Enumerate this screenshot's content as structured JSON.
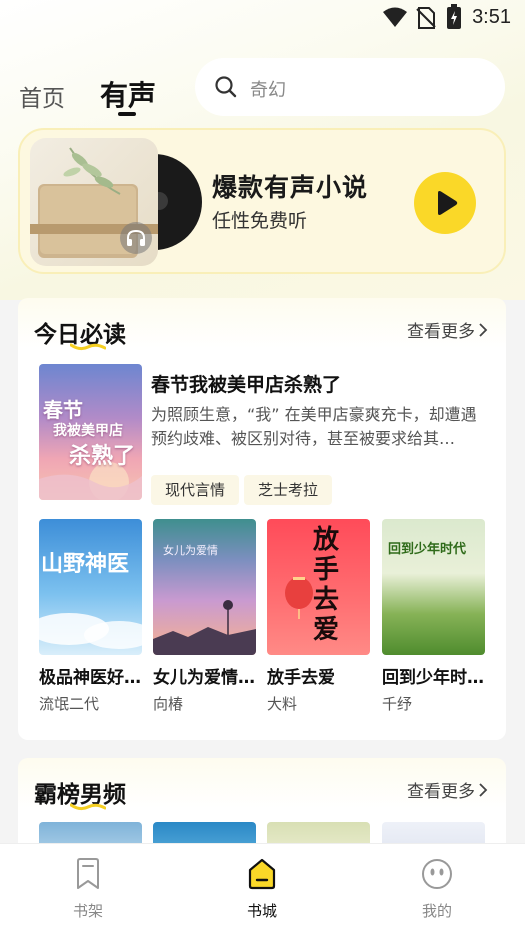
{
  "status_bar": {
    "time": "3:51",
    "icons": [
      "wifi-icon",
      "no-sim-icon",
      "battery-charging-icon"
    ]
  },
  "header": {
    "tabs": [
      {
        "label": "首页"
      },
      {
        "label": "有声",
        "active": true
      }
    ],
    "search": {
      "placeholder": "奇幻",
      "icon": "search-icon"
    }
  },
  "banner": {
    "title": "爆款有声小说",
    "subtitle": "任性免费听",
    "icon": "play-icon"
  },
  "today_section": {
    "title": "今日必读",
    "more_label": "查看更多",
    "featured": {
      "cover_text": [
        "春节",
        "我被美甲店",
        "杀熟了"
      ],
      "title": "春节我被美甲店杀熟了",
      "description": "为照顾生意，“我” 在美甲店豪爽充卡，却遭遇预约歧难、被区别对待，甚至被要求给其…",
      "tags": [
        "现代言情",
        "芝士考拉"
      ]
    },
    "books": [
      {
        "name": "极品神医好…",
        "author": "流氓二代",
        "cover_text": "山野神医"
      },
      {
        "name": "女儿为爱情…",
        "author": "向椿",
        "cover_text": "女儿为爱情"
      },
      {
        "name": "放手去爱",
        "author": "大料",
        "cover_text": "放手去爱"
      },
      {
        "name": "回到少年时…",
        "author": "千纾",
        "cover_text": "回到少年时代"
      }
    ]
  },
  "male_section": {
    "title": "霸榜男频",
    "more_label": "查看更多"
  },
  "bottom_nav": [
    {
      "label": "书架",
      "icon": "bookmark-icon"
    },
    {
      "label": "书城",
      "icon": "bookstore-icon",
      "active": true
    },
    {
      "label": "我的",
      "icon": "profile-face-icon"
    }
  ],
  "colors": {
    "accent": "#fad828",
    "tag_bg": "#fbf7e6",
    "banner_bg": "#fdf8e0"
  }
}
